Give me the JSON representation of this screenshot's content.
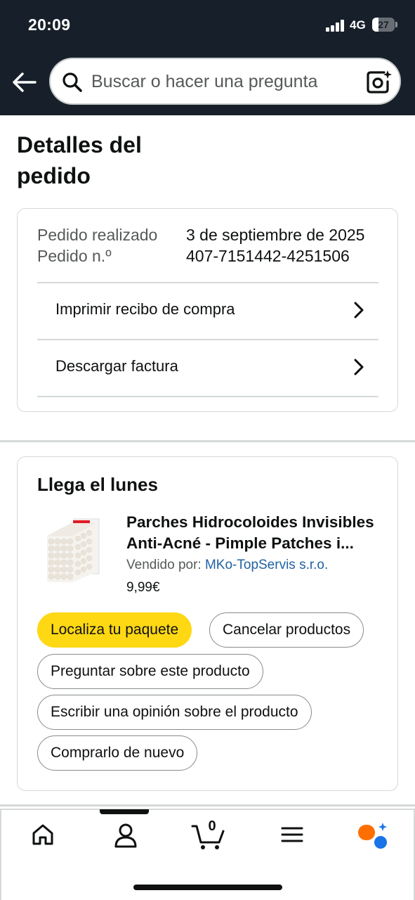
{
  "status_bar": {
    "time": "20:09",
    "network": "4G",
    "battery": "27",
    "battery_level": 0.27
  },
  "search": {
    "placeholder": "Buscar o hacer una pregunta"
  },
  "page": {
    "title": "Detalles del pedido"
  },
  "order": {
    "placed_label": "Pedido realizado",
    "placed_value": "3 de septiembre de 2025",
    "number_label": "Pedido n.º",
    "number_value": "407-7151442-4251506",
    "links": [
      {
        "label": "Imprimir recibo de compra"
      },
      {
        "label": "Descargar factura"
      }
    ]
  },
  "shipment": {
    "arrival": "Llega el lunes",
    "product": {
      "title": "Parches Hidrocoloides Invisibles Anti-Acné - Pimple Patches i...",
      "seller_label": "Vendido por:",
      "seller_name": "MKo-TopServis s.r.o.",
      "price": "9,99€"
    },
    "buttons": {
      "track": "Localiza tu paquete",
      "cancel": "Cancelar productos",
      "ask": "Preguntar sobre este producto",
      "review": "Escribir una opinión sobre el producto",
      "buy_again": "Comprarlo de nuevo"
    }
  },
  "bottom_nav": {
    "items": [
      "home-icon",
      "account-icon",
      "cart-icon",
      "menu-icon",
      "rufus-icon"
    ],
    "cart_count": "0"
  },
  "colors": {
    "header_bg": "#17202a",
    "primary_button": "#ffd814",
    "link": "#2162a1",
    "rufus_orange": "#ff6f00",
    "rufus_blue": "#1a73e8"
  }
}
